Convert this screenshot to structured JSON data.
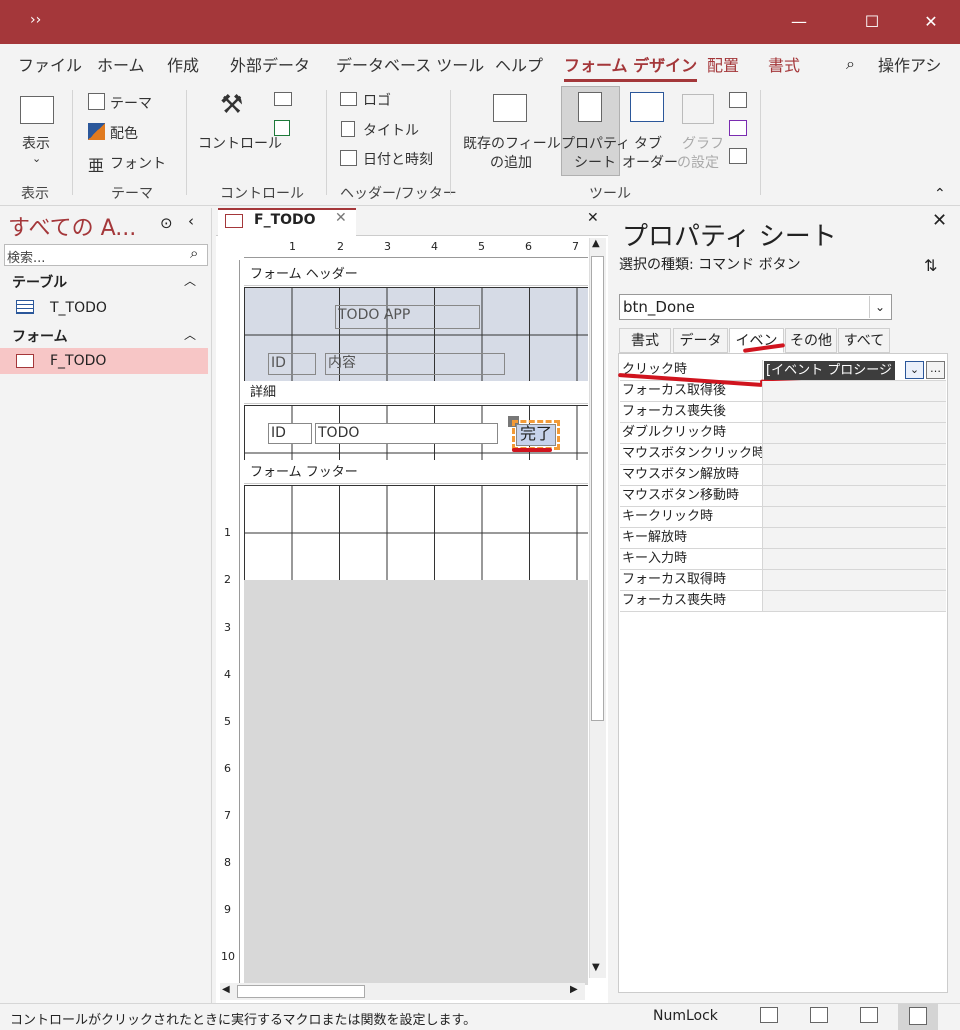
{
  "titlebar": {
    "qa_label": "››",
    "minimize": "—",
    "maximize": "☐",
    "close": "✕"
  },
  "menu": [
    "ファイル",
    "ホーム",
    "作成",
    "外部データ",
    "データベース ツール",
    "ヘルプ",
    "フォーム デザイン",
    "配置",
    "書式"
  ],
  "search": {
    "label": "操作アシ"
  },
  "ribbon": {
    "view": "表示",
    "view_group": "表示",
    "theme": "テーマ",
    "color": "配色",
    "font": "フォント",
    "theme_group": "テーマ",
    "controls": "コントロール",
    "controls_group": "コントロール",
    "logo": "ロゴ",
    "title": "タイトル",
    "datetime": "日付と時刻",
    "hf_group": "ヘッダー/フッター",
    "add_field_1": "既存のフィールド",
    "add_field_2": "の追加",
    "prop_1": "プロパティ",
    "prop_2": "シート",
    "tab_1": "タブ",
    "tab_2": "オーダー",
    "graph_1": "グラフ",
    "graph_2": "の設定",
    "tools_group": "ツール"
  },
  "nav": {
    "title": "すべての A...",
    "search_placeholder": "検索...",
    "tables_header": "テーブル",
    "tables": [
      "T_TODO"
    ],
    "forms_header": "フォーム",
    "forms": [
      "F_TODO"
    ]
  },
  "document": {
    "tab": "F_TODO",
    "ruler": [
      "1",
      "2",
      "3",
      "4",
      "5",
      "6",
      "7"
    ],
    "vruler": [
      "1",
      "2",
      "3",
      "4",
      "5",
      "6",
      "7",
      "8",
      "9",
      "10"
    ],
    "sections": {
      "header": "フォーム ヘッダー",
      "detail": "詳細",
      "footer": "フォーム フッター"
    },
    "header_label": "TODO  APP",
    "header_id": "ID",
    "header_content": "内容",
    "detail_id": "ID",
    "detail_todo": "TODO",
    "button": "完了"
  },
  "property_sheet": {
    "title": "プロパティ シート",
    "selection_type": "選択の種類: コマンド ボタン",
    "object": "btn_Done",
    "tabs": [
      "書式",
      "データ",
      "イベント",
      "その他",
      "すべて"
    ],
    "active_tab": "イベント",
    "rows": [
      {
        "name": "クリック時",
        "value": "[イベント プロシージャ]"
      },
      {
        "name": "フォーカス取得後",
        "value": ""
      },
      {
        "name": "フォーカス喪失後",
        "value": ""
      },
      {
        "name": "ダブルクリック時",
        "value": ""
      },
      {
        "name": "マウスボタンクリック時",
        "value": ""
      },
      {
        "name": "マウスボタン解放時",
        "value": ""
      },
      {
        "name": "マウスボタン移動時",
        "value": ""
      },
      {
        "name": "キークリック時",
        "value": ""
      },
      {
        "name": "キー解放時",
        "value": ""
      },
      {
        "name": "キー入力時",
        "value": ""
      },
      {
        "name": "フォーカス取得時",
        "value": ""
      },
      {
        "name": "フォーカス喪失時",
        "value": ""
      }
    ]
  },
  "status": {
    "message": "コントロールがクリックされたときに実行するマクロまたは関数を設定します。",
    "numlock": "NumLock"
  },
  "colors": {
    "accent": "#a4373a",
    "highlight": "#d0141e"
  }
}
